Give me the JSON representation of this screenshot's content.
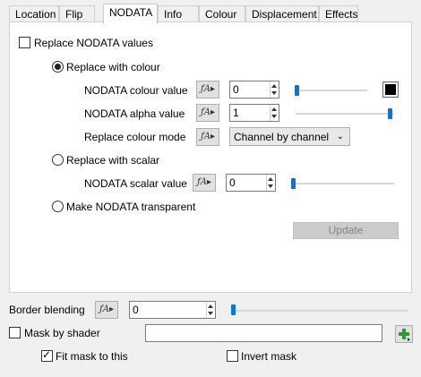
{
  "tabs": [
    "Location",
    "Flip",
    "NODATA",
    "Info",
    "Colour",
    "Displacement",
    "Effects"
  ],
  "active_tab": "NODATA",
  "nodata": {
    "replace_label": "Replace NODATA values",
    "replace_checked": false,
    "with_colour_label": "Replace with colour",
    "with_colour_selected": true,
    "colour_value_label": "NODATA colour value",
    "colour_value": "0",
    "colour_swatch": "#000000",
    "alpha_value_label": "NODATA alpha value",
    "alpha_value": "1",
    "colour_mode_label": "Replace colour mode",
    "colour_mode": "Channel by channel",
    "with_scalar_label": "Replace with scalar",
    "scalar_value_label": "NODATA scalar value",
    "scalar_value": "0",
    "transparent_label": "Make NODATA transparent",
    "update_label": "Update"
  },
  "bottom": {
    "border_blending_label": "Border blending",
    "border_blending_value": "0",
    "mask_label": "Mask by shader",
    "mask_value": "",
    "fit_mask_label": "Fit mask to this",
    "fit_mask_checked": true,
    "invert_mask_label": "Invert mask",
    "invert_mask_checked": false
  },
  "icons": {
    "expression": "expression-icon",
    "add": "add-plus-icon"
  },
  "colors": {
    "accent": "#0078d7",
    "add_icon": "#2e9b2e"
  }
}
